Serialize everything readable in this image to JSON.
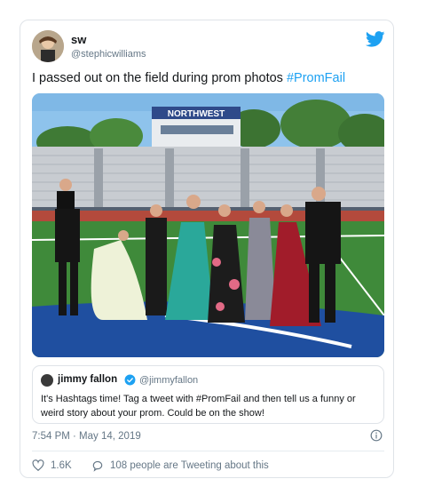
{
  "tweet": {
    "display_name": "sw",
    "handle": "@stephicwilliams",
    "text": "I passed out on the field during prom photos ",
    "hashtag": "#PromFail",
    "timestamp": "7:54 PM · May 14, 2019",
    "likes": "1.6K",
    "tweeting_text": "108 people are Tweeting about this",
    "stadium_sign": "NORTHWEST"
  },
  "quoted_tweet": {
    "display_name": "jimmy fallon",
    "handle": "@jimmyfallon",
    "text": "It's Hashtags time! Tag a tweet with #PromFail and then tell us a funny or weird story about your prom. Could be on the show!"
  },
  "colors": {
    "twitter_blue": "#1da1f2",
    "secondary_text": "#657786",
    "border": "#dfe3e8"
  },
  "icons": [
    "twitter-bird-icon",
    "verified-badge-icon",
    "info-icon",
    "heart-icon",
    "reply-icon"
  ]
}
